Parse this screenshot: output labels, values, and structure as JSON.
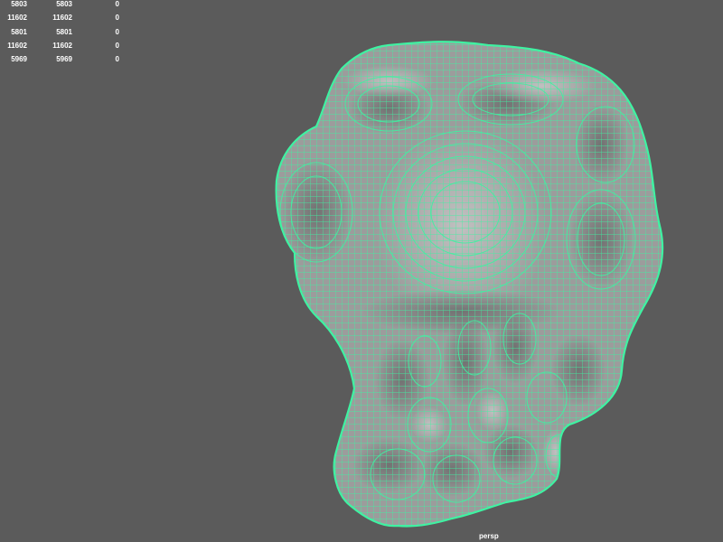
{
  "viewport": {
    "camera_label": "persp",
    "wireframe_color": "#3ff2a2",
    "background_color": "#5b5b5b",
    "surface_color": "#9c9c9c"
  },
  "hud": {
    "rows": [
      {
        "a": "5803",
        "b": "5803",
        "c": "0"
      },
      {
        "a": "11602",
        "b": "11602",
        "c": "0"
      },
      {
        "a": "5801",
        "b": "5801",
        "c": "0"
      },
      {
        "a": "11602",
        "b": "11602",
        "c": "0"
      },
      {
        "a": "5969",
        "b": "5969",
        "c": "0"
      }
    ]
  },
  "icons": {
    "mesh": "sculpted-mesh-icon"
  }
}
